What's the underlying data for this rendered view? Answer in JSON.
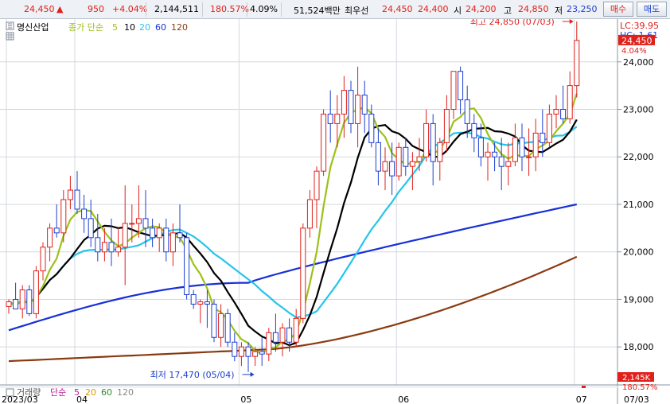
{
  "quote": {
    "price": "24,450",
    "arrow": "▲",
    "change": "950",
    "change_pct": "+4.04%",
    "volume": "2,144,511",
    "volume_ratio": "180.57%",
    "turnover": "4.09%",
    "amount": "51,524백만",
    "best_ask_label": "최우선",
    "best_ask": "24,450",
    "best_bid": "24,400",
    "open_label": "시",
    "open": "24,200",
    "high_label": "고",
    "high": "24,850",
    "low_label": "저",
    "low": "23,250",
    "buy_label": "매수",
    "sell_label": "매도"
  },
  "colors": {
    "up": "#e0201a",
    "down": "#1c3fd0",
    "ma5": "#9dc11a",
    "ma10": "#000000",
    "ma20": "#27c4ea",
    "ma60": "#1730d8",
    "ma120": "#8a3a10"
  },
  "chart_data": {
    "type": "candlestick",
    "legend": {
      "stock_name": "명신산업",
      "prefix": "종가 단순",
      "periods": [
        "5",
        "10",
        "20",
        "60",
        "120"
      ]
    },
    "right_info": {
      "lc": "LC:39.95",
      "hc": "HC:-1.61"
    },
    "ylim": [
      17200,
      24900
    ],
    "y_ticks": [
      18000,
      19000,
      20000,
      21000,
      22000,
      23000,
      24000
    ],
    "y_tick_labels": [
      "18,000",
      "19,000",
      "20,000",
      "21,000",
      "22,000",
      "23,000",
      "24,000"
    ],
    "current_price_label": "24,450",
    "current_change_label": "4.04%",
    "annotations": {
      "high": {
        "text": "최고 24,850 (07/03)",
        "value": 24850,
        "index": 83
      },
      "low": {
        "text": "최저 17,470 (05/04)",
        "value": 17470,
        "index": 36
      }
    },
    "x_labels": [
      {
        "text": "2023/03",
        "index": 0
      },
      {
        "text": "04",
        "index": 10
      },
      {
        "text": "05",
        "index": 34
      },
      {
        "text": "06",
        "index": 57
      },
      {
        "text": "07",
        "index": 83
      }
    ],
    "right_date": "07/03",
    "volume_panel": {
      "label": "거래량",
      "ma_prefix": "단순",
      "periods": [
        "5",
        "20",
        "60",
        "120"
      ],
      "last_volume": "2,145K",
      "ratio": "180.57%"
    },
    "candles": [
      [
        18850,
        19000,
        18700,
        18950
      ],
      [
        19000,
        19350,
        18800,
        18800
      ],
      [
        18800,
        19300,
        18600,
        19200
      ],
      [
        19200,
        19300,
        18650,
        18700
      ],
      [
        18700,
        19700,
        18600,
        19600
      ],
      [
        19600,
        20200,
        19400,
        20100
      ],
      [
        20100,
        20600,
        19800,
        20500
      ],
      [
        20500,
        21000,
        20300,
        20400
      ],
      [
        20400,
        21300,
        20200,
        21100
      ],
      [
        21100,
        21600,
        20900,
        21300
      ],
      [
        21300,
        21700,
        20800,
        20900
      ],
      [
        20900,
        21200,
        20400,
        20700
      ],
      [
        20700,
        21100,
        20100,
        20300
      ],
      [
        20300,
        20800,
        19800,
        20000
      ],
      [
        20000,
        20500,
        19800,
        20200
      ],
      [
        20200,
        20700,
        19700,
        20000
      ],
      [
        20000,
        20500,
        19900,
        20100
      ],
      [
        20100,
        21400,
        19300,
        20600
      ],
      [
        20600,
        21000,
        20200,
        20600
      ],
      [
        20600,
        21400,
        20300,
        20700
      ],
      [
        20700,
        21300,
        20100,
        20500
      ],
      [
        20500,
        20700,
        20100,
        20300
      ],
      [
        20300,
        20600,
        20000,
        20500
      ],
      [
        20500,
        20700,
        19800,
        20000
      ],
      [
        20000,
        20600,
        19700,
        20400
      ],
      [
        20400,
        21000,
        20200,
        20300
      ],
      [
        20300,
        20400,
        19000,
        19100
      ],
      [
        19100,
        19200,
        18800,
        18900
      ],
      [
        18900,
        19000,
        18500,
        18950
      ],
      [
        18950,
        19200,
        18400,
        18900
      ],
      [
        18900,
        19000,
        18100,
        18200
      ],
      [
        18200,
        18900,
        18000,
        18700
      ],
      [
        18700,
        18800,
        18000,
        18100
      ],
      [
        18100,
        18300,
        17700,
        17800
      ],
      [
        17800,
        18100,
        17600,
        18000
      ],
      [
        18000,
        18100,
        17470,
        17800
      ],
      [
        17800,
        18000,
        17600,
        17900
      ],
      [
        17900,
        18200,
        17600,
        17850
      ],
      [
        17850,
        18400,
        17700,
        18300
      ],
      [
        18300,
        18700,
        17900,
        18100
      ],
      [
        18100,
        18500,
        17800,
        18400
      ],
      [
        18400,
        18600,
        17900,
        18100
      ],
      [
        18100,
        18800,
        18000,
        18600
      ],
      [
        18600,
        20600,
        18500,
        20500
      ],
      [
        20500,
        21300,
        20300,
        21100
      ],
      [
        21100,
        21800,
        20500,
        21700
      ],
      [
        21700,
        23000,
        21600,
        22900
      ],
      [
        22900,
        23400,
        22300,
        22700
      ],
      [
        22700,
        23300,
        22200,
        22900
      ],
      [
        22900,
        23700,
        22400,
        23400
      ],
      [
        23400,
        23600,
        22500,
        22700
      ],
      [
        22700,
        23900,
        22200,
        23300
      ],
      [
        23300,
        23600,
        22500,
        22900
      ],
      [
        22900,
        23100,
        22200,
        22300
      ],
      [
        22300,
        22600,
        21400,
        21700
      ],
      [
        21700,
        22200,
        21300,
        21900
      ],
      [
        21900,
        22300,
        21200,
        21600
      ],
      [
        21600,
        22300,
        21500,
        22200
      ],
      [
        22200,
        22400,
        21600,
        21800
      ],
      [
        21800,
        22100,
        21300,
        21900
      ],
      [
        21900,
        22400,
        21700,
        22000
      ],
      [
        22000,
        23000,
        21900,
        22700
      ],
      [
        22700,
        22900,
        21400,
        21900
      ],
      [
        21900,
        22400,
        21500,
        22300
      ],
      [
        22300,
        23300,
        22100,
        23000
      ],
      [
        23000,
        23800,
        22800,
        23800
      ],
      [
        23800,
        23900,
        22900,
        23200
      ],
      [
        23200,
        23500,
        22400,
        22700
      ],
      [
        22700,
        22900,
        22100,
        22400
      ],
      [
        22400,
        22700,
        21800,
        22000
      ],
      [
        22000,
        22300,
        21500,
        22100
      ],
      [
        22100,
        22300,
        21700,
        22000
      ],
      [
        22000,
        22400,
        21300,
        21800
      ],
      [
        21800,
        22300,
        21400,
        21900
      ],
      [
        21900,
        22700,
        21800,
        22400
      ],
      [
        22400,
        22700,
        21700,
        22000
      ],
      [
        22000,
        22600,
        21600,
        22000
      ],
      [
        22000,
        22800,
        21700,
        22500
      ],
      [
        22500,
        23000,
        22000,
        22300
      ],
      [
        22300,
        23100,
        22200,
        22900
      ],
      [
        22900,
        23300,
        22600,
        23000
      ],
      [
        23000,
        23500,
        22700,
        22800
      ],
      [
        22800,
        23800,
        22700,
        23500
      ],
      [
        23500,
        24850,
        23250,
        24450
      ]
    ]
  }
}
